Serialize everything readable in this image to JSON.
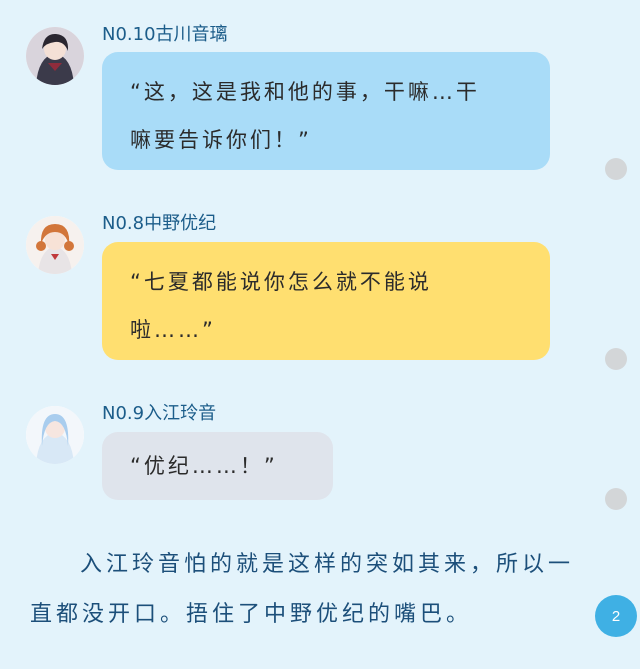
{
  "messages": [
    {
      "name": "N0.10古川音璃",
      "lines": [
        "“这，这是我和他的事，干嘛…干",
        "嘛要告诉你们！”"
      ],
      "bubble_color": "#a9dcf8"
    },
    {
      "name": "N0.8中野优纪",
      "lines": [
        "“七夏都能说你怎么就不能说",
        "啦……”"
      ],
      "bubble_color": "#ffdf70"
    },
    {
      "name": "N0.9入江玲音",
      "lines": [
        "“优纪……！”"
      ],
      "bubble_color": "#dfe4ec"
    }
  ],
  "narration": {
    "lines": [
      "入江玲音怕的就是这样的突如其来，所以一",
      "直都没开口。捂住了中野优纪的嘴巴。"
    ]
  },
  "page_badge": "2",
  "colors": {
    "background": "#e3f3fb",
    "name_text": "#1c5d8a",
    "narration_text": "#1c4f7a",
    "badge": "#3fb0e4"
  },
  "icons": [
    "avatar-furukawa",
    "avatar-nakano",
    "avatar-irie",
    "more-dot"
  ]
}
